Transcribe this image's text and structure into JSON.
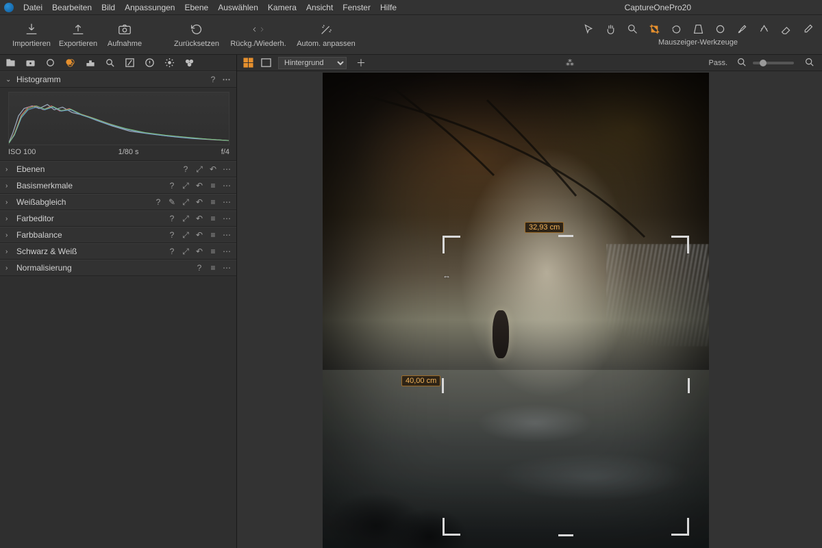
{
  "app": {
    "title": "CaptureOnePro20"
  },
  "menu": [
    "Datei",
    "Bearbeiten",
    "Bild",
    "Anpassungen",
    "Ebene",
    "Auswählen",
    "Kamera",
    "Ansicht",
    "Fenster",
    "Hilfe"
  ],
  "toolbar": {
    "import": "Importieren",
    "export": "Exportieren",
    "capture": "Aufnahme",
    "reset": "Zurücksetzen",
    "undoredo": "Rückg./Wiederh.",
    "autoadjust": "Autom. anpassen"
  },
  "cursorTools": {
    "label": "Mauszeiger-Werkzeuge"
  },
  "viewerBar": {
    "layerSelected": "Hintergrund",
    "passLabel": "Pass."
  },
  "histogram": {
    "title": "Histogramm",
    "iso": "ISO 100",
    "shutter": "1/80 s",
    "aperture": "f/4"
  },
  "panels": [
    {
      "title": "Ebenen",
      "actions": [
        "?",
        "⤢",
        "↶",
        "⋯"
      ]
    },
    {
      "title": "Basismerkmale",
      "actions": [
        "?",
        "⤢",
        "↶",
        "≡",
        "⋯"
      ]
    },
    {
      "title": "Weißabgleich",
      "actions": [
        "?",
        "✎",
        "⤢",
        "↶",
        "≡",
        "⋯"
      ]
    },
    {
      "title": "Farbeditor",
      "actions": [
        "?",
        "⤢",
        "↶",
        "≡",
        "⋯"
      ]
    },
    {
      "title": "Farbbalance",
      "actions": [
        "?",
        "⤢",
        "↶",
        "≡",
        "⋯"
      ]
    },
    {
      "title": "Schwarz & Weiß",
      "actions": [
        "?",
        "⤢",
        "↶",
        "≡",
        "⋯"
      ]
    },
    {
      "title": "Normalisierung",
      "actions": [
        "?",
        "≡",
        "⋯"
      ]
    }
  ],
  "crop": {
    "width": "32,93 cm",
    "height": "40,00 cm"
  }
}
